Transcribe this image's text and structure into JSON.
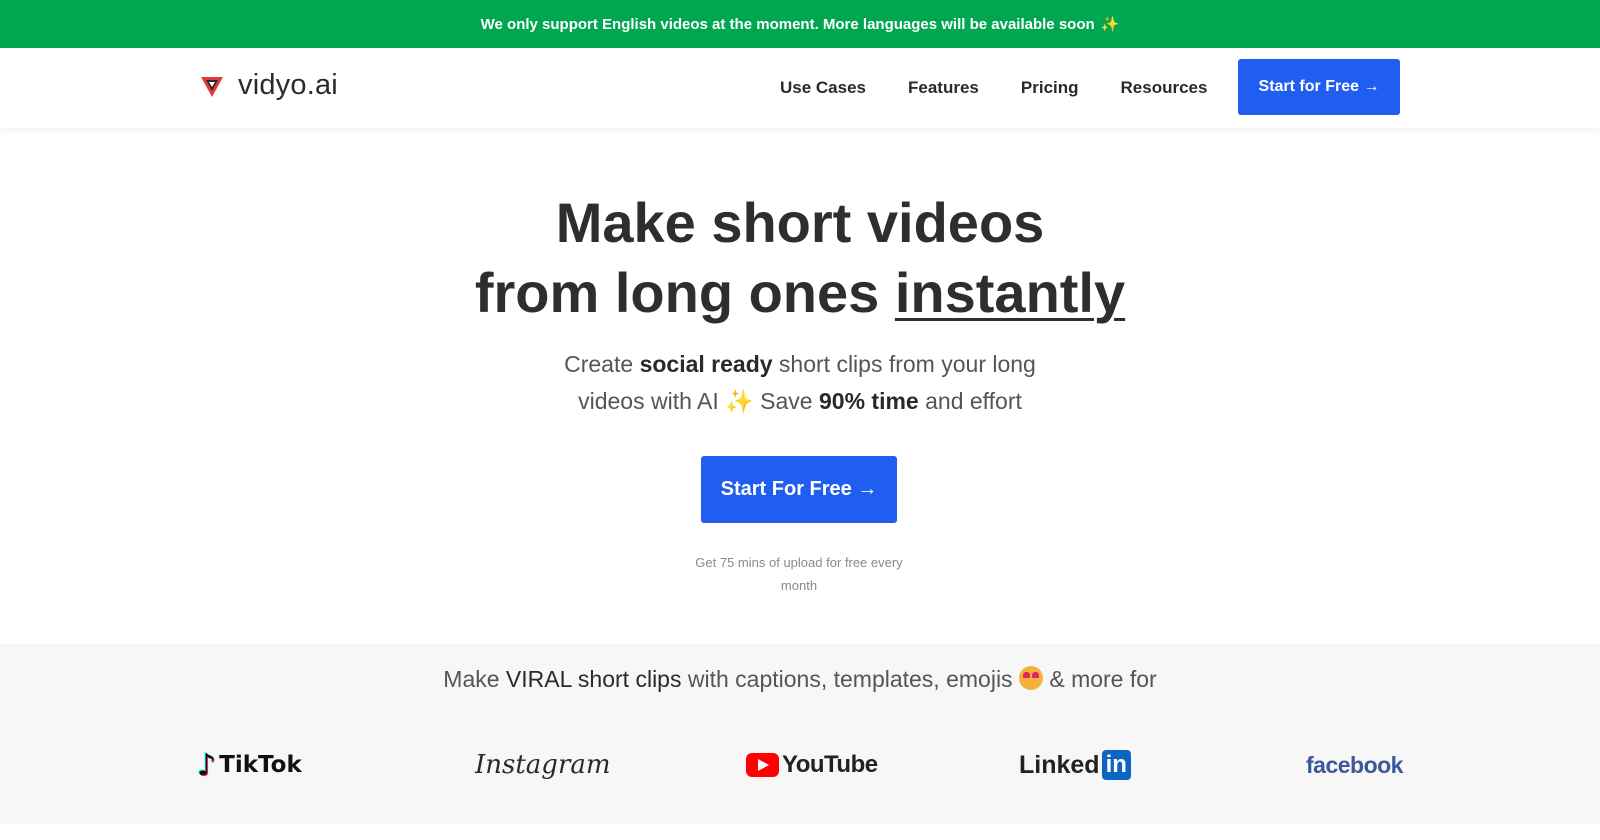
{
  "banner": {
    "text": "We only support English videos at the moment. More languages will be available soon",
    "emoji": "✨"
  },
  "header": {
    "logo_text": "vidyo.ai",
    "nav": [
      "Use Cases",
      "Features",
      "Pricing",
      "Resources"
    ],
    "cta_label": "Start for Free →"
  },
  "hero": {
    "title_line1": "Make short videos",
    "title_line2_prefix": "from long ones ",
    "title_line2_emphasis": "instantly",
    "subtitle": {
      "part1": "Create ",
      "bold1": "social ready",
      "part2": " short clips from your long",
      "part3": "videos with AI ",
      "emoji": "✨",
      "part4": " Save ",
      "bold2": "90% time",
      "part5": " and effort"
    },
    "cta_label": "Start For Free →",
    "note": "Get 75 mins of upload for free every month"
  },
  "platforms": {
    "heading_prefix": "Make ",
    "heading_bold": "VIRAL short clips",
    "heading_suffix": " with captions, templates, emojis",
    "heading_end": " & more for",
    "logos": {
      "tiktok": "TikTok",
      "instagram": "Instagram",
      "youtube": "YouTube",
      "linkedin_text": "Linked",
      "linkedin_box": "in",
      "facebook": "facebook"
    }
  },
  "colors": {
    "banner_bg": "#00a650",
    "primary": "#1f5ef0",
    "platforms_bg": "#f7f7f7"
  }
}
